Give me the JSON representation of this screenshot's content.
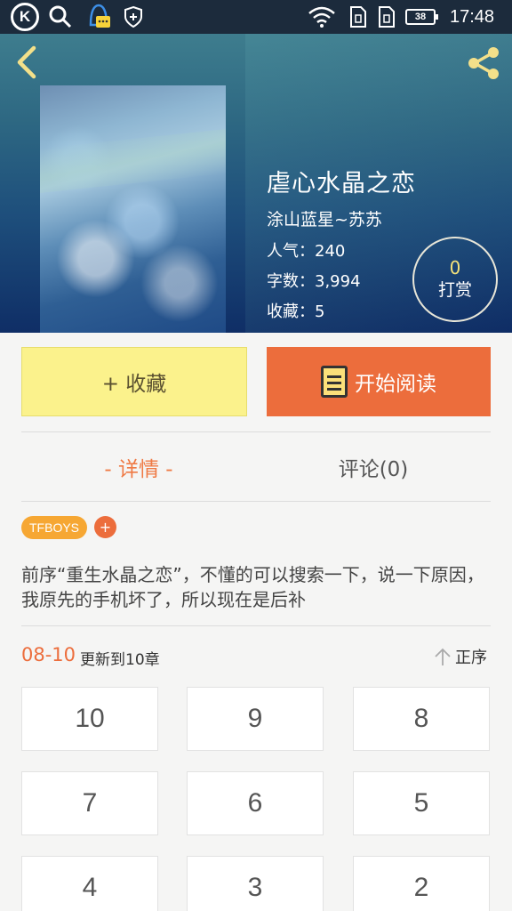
{
  "status_bar": {
    "k_icon": "K",
    "battery": "38",
    "time": "17:48"
  },
  "header": {
    "book_title": "虐心水晶之恋",
    "author": "涂山蓝星~苏苏",
    "popularity": "人气：240",
    "word_count": "字数：3,994",
    "favorites": "收藏：5",
    "tip_count": "0",
    "tip_label": "打赏"
  },
  "actions": {
    "favorite_label": "+ 收藏",
    "read_label": "开始阅读"
  },
  "tabs": {
    "detail": "- 详情 -",
    "comments": "评论(0)"
  },
  "tags": [
    "TFBOYS"
  ],
  "tag_add": "+",
  "description": "前序“重生水晶之恋”，不懂的可以搜索一下，说一下原因，我原先的手机坏了，所以现在是后补",
  "update": {
    "date": "08-10",
    "text": "更新到10章",
    "sort_label": "正序"
  },
  "chapters": [
    "10",
    "9",
    "8",
    "7",
    "6",
    "5",
    "4",
    "3",
    "2"
  ],
  "colors": {
    "accent_orange": "#ec6d3c",
    "favorite_yellow": "#fbf28c",
    "tag_orange": "#f6a733",
    "header_dark": "#0f2e66"
  },
  "icons": [
    "k-app-icon",
    "search-icon",
    "qq-bell-icon",
    "shield-icon",
    "wifi-icon",
    "sim-icon",
    "battery-icon",
    "back-icon",
    "share-icon",
    "book-icon",
    "up-arrow-icon"
  ]
}
